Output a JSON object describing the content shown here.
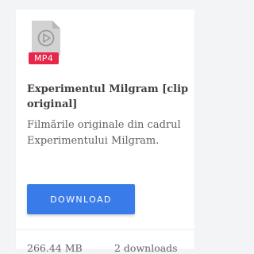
{
  "file": {
    "icon": "video-play-icon",
    "extension": "MP4",
    "badge_color": "#e8264b",
    "title": "Experimentul Milgram [clip original]",
    "description": "Filmările originale din cadrul Experimentului Milgram.",
    "size": "266.44 MB",
    "downloads": "2 downloads"
  },
  "actions": {
    "download_label": "DOWNLOAD",
    "download_color": "#3a7bea"
  }
}
